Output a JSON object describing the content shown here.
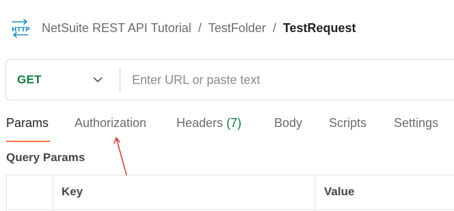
{
  "breadcrumb": {
    "icon": "http-icon",
    "collection": "NetSuite REST API Tutorial",
    "separator": "/",
    "folder": "TestFolder",
    "current": "TestRequest"
  },
  "request": {
    "method": "GET",
    "url_value": "",
    "url_placeholder": "Enter URL or paste text"
  },
  "tabs": [
    {
      "label": "Params",
      "active": true
    },
    {
      "label": "Authorization",
      "active": false
    },
    {
      "label": "Headers",
      "count": "(7)",
      "active": false
    },
    {
      "label": "Body",
      "active": false
    },
    {
      "label": "Scripts",
      "active": false
    },
    {
      "label": "Settings",
      "active": false
    }
  ],
  "query_params": {
    "title": "Query Params",
    "columns": [
      "Key",
      "Value"
    ]
  },
  "colors": {
    "method_get": "#0e7a3a",
    "active_tab_underline": "#ff6c37",
    "annotation_arrow": "#d32f2f",
    "http_icon": "#1a8fbf"
  }
}
